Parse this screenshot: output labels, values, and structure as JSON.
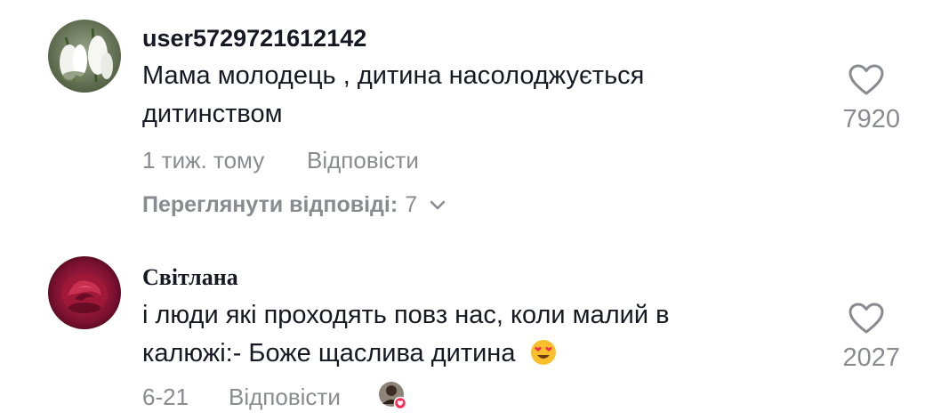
{
  "comments": [
    {
      "username": "user5729721612142",
      "text": "Мама молодець , дитина насолоджується дитинством",
      "emoji_icon": "",
      "time": "1 тиж. тому",
      "reply_label": "Відповісти",
      "likes": "7920",
      "view_replies_label": "Переглянути відповіді:",
      "view_replies_count": "7",
      "avatar_icon": "snowdrop-flower-avatar"
    },
    {
      "username": "Світлана",
      "text": "і люди які проходять повз нас, коли малий в калюжі:- Боже щаслива дитина",
      "emoji_icon": "heart-eyes-emoji",
      "time": "6-21",
      "reply_label": "Відповісти",
      "likes": "2027",
      "avatar_icon": "red-rose-avatar",
      "creator_liked_icon": "creator-liked-avatar-heart"
    }
  ],
  "colors": {
    "primary_text": "#161823",
    "secondary_text": "#8a8b91",
    "heart_badge": "#fe2c55"
  }
}
